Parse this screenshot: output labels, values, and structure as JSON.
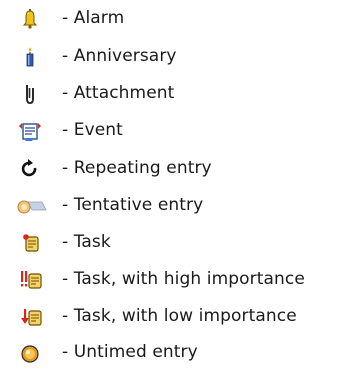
{
  "legend": {
    "items": [
      {
        "icon": "alarm-bell-icon",
        "label": "- Alarm"
      },
      {
        "icon": "anniversary-candle-icon",
        "label": "- Anniversary"
      },
      {
        "icon": "attachment-clip-icon",
        "label": "- Attachment"
      },
      {
        "icon": "event-icon",
        "label": "- Event"
      },
      {
        "icon": "repeating-arrow-icon",
        "label": "- Repeating entry"
      },
      {
        "icon": "tentative-entry-icon",
        "label": "- Tentative entry"
      },
      {
        "icon": "task-icon",
        "label": "- Task"
      },
      {
        "icon": "task-high-importance-icon",
        "label": "- Task, with high importance"
      },
      {
        "icon": "task-low-importance-icon",
        "label": "- Task, with low importance"
      },
      {
        "icon": "untimed-entry-icon",
        "label": "- Untimed entry"
      }
    ]
  }
}
